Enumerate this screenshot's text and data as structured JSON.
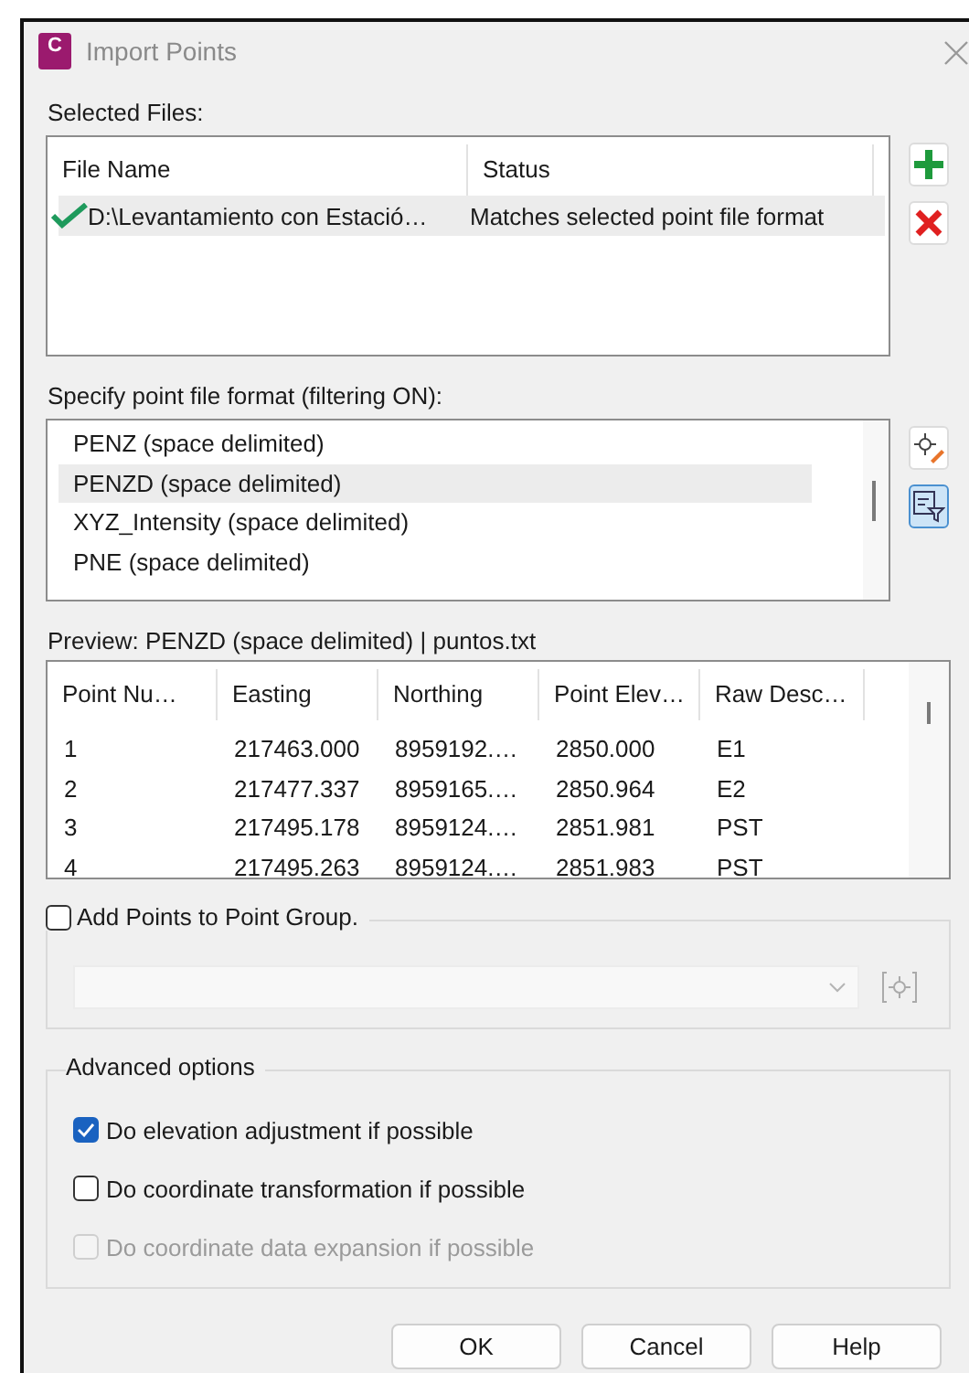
{
  "window": {
    "title": "Import Points",
    "app_badge": "C"
  },
  "selected_files": {
    "label": "Selected Files:",
    "columns": [
      "File Name",
      "Status"
    ],
    "rows": [
      {
        "file": "D:\\Levantamiento con Estació…",
        "status": "Matches selected point file format",
        "valid": true,
        "selected": true
      }
    ]
  },
  "format": {
    "label": "Specify point file format (filtering ON):",
    "items": [
      {
        "label": "PENZ (space delimited)",
        "selected": false
      },
      {
        "label": "PENZD (space delimited)",
        "selected": true
      },
      {
        "label": "XYZ_Intensity (space delimited)",
        "selected": false
      },
      {
        "label": "PNE (space delimited)",
        "selected": false
      }
    ],
    "filter_on": true
  },
  "preview": {
    "label": "Preview: PENZD (space delimited) | puntos.txt",
    "columns": [
      "Point Nu…",
      "Easting",
      "Northing",
      "Point Elev…",
      "Raw Desc…"
    ],
    "rows": [
      [
        "1",
        "217463.000",
        "8959192.…",
        "2850.000",
        "E1"
      ],
      [
        "2",
        "217477.337",
        "8959165.…",
        "2850.964",
        "E2"
      ],
      [
        "3",
        "217495.178",
        "8959124.…",
        "2851.981",
        "PST"
      ],
      [
        "4",
        "217495.263",
        "8959124.…",
        "2851.983",
        "PST"
      ]
    ]
  },
  "point_group": {
    "label": "Add Points to Point Group.",
    "checked": false
  },
  "advanced": {
    "label": "Advanced options",
    "options": [
      {
        "label": "Do elevation adjustment if possible",
        "checked": true,
        "disabled": false
      },
      {
        "label": "Do coordinate transformation if possible",
        "checked": false,
        "disabled": false
      },
      {
        "label": "Do coordinate data expansion if possible",
        "checked": false,
        "disabled": true
      }
    ]
  },
  "buttons": [
    "OK",
    "Cancel",
    "Help"
  ]
}
